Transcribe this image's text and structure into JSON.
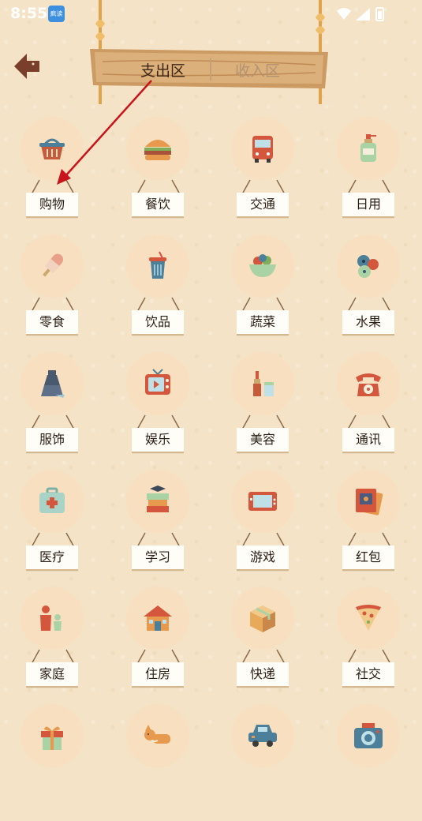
{
  "status": {
    "time": "8:55",
    "notif_badge": "疯读"
  },
  "header": {
    "tab_expense": "支出区",
    "tab_income": "收入区"
  },
  "categories": [
    {
      "label": "购物",
      "icon": "shopping-basket-icon"
    },
    {
      "label": "餐饮",
      "icon": "burger-icon"
    },
    {
      "label": "交通",
      "icon": "bus-icon"
    },
    {
      "label": "日用",
      "icon": "soap-bottle-icon"
    },
    {
      "label": "零食",
      "icon": "popsicle-icon"
    },
    {
      "label": "饮品",
      "icon": "drink-cup-icon"
    },
    {
      "label": "蔬菜",
      "icon": "salad-bowl-icon"
    },
    {
      "label": "水果",
      "icon": "berries-icon"
    },
    {
      "label": "服饰",
      "icon": "dress-icon"
    },
    {
      "label": "娱乐",
      "icon": "tv-icon"
    },
    {
      "label": "美容",
      "icon": "lipstick-icon"
    },
    {
      "label": "通讯",
      "icon": "telephone-icon"
    },
    {
      "label": "医疗",
      "icon": "first-aid-kit-icon"
    },
    {
      "label": "学习",
      "icon": "books-icon"
    },
    {
      "label": "游戏",
      "icon": "game-console-icon"
    },
    {
      "label": "红包",
      "icon": "red-envelope-icon"
    },
    {
      "label": "家庭",
      "icon": "family-icon"
    },
    {
      "label": "住房",
      "icon": "house-icon"
    },
    {
      "label": "快递",
      "icon": "package-icon"
    },
    {
      "label": "社交",
      "icon": "pizza-icon"
    },
    {
      "label": "",
      "icon": "gift-icon"
    },
    {
      "label": "",
      "icon": "dog-icon"
    },
    {
      "label": "",
      "icon": "car-icon"
    },
    {
      "label": "",
      "icon": "camera-icon"
    }
  ]
}
